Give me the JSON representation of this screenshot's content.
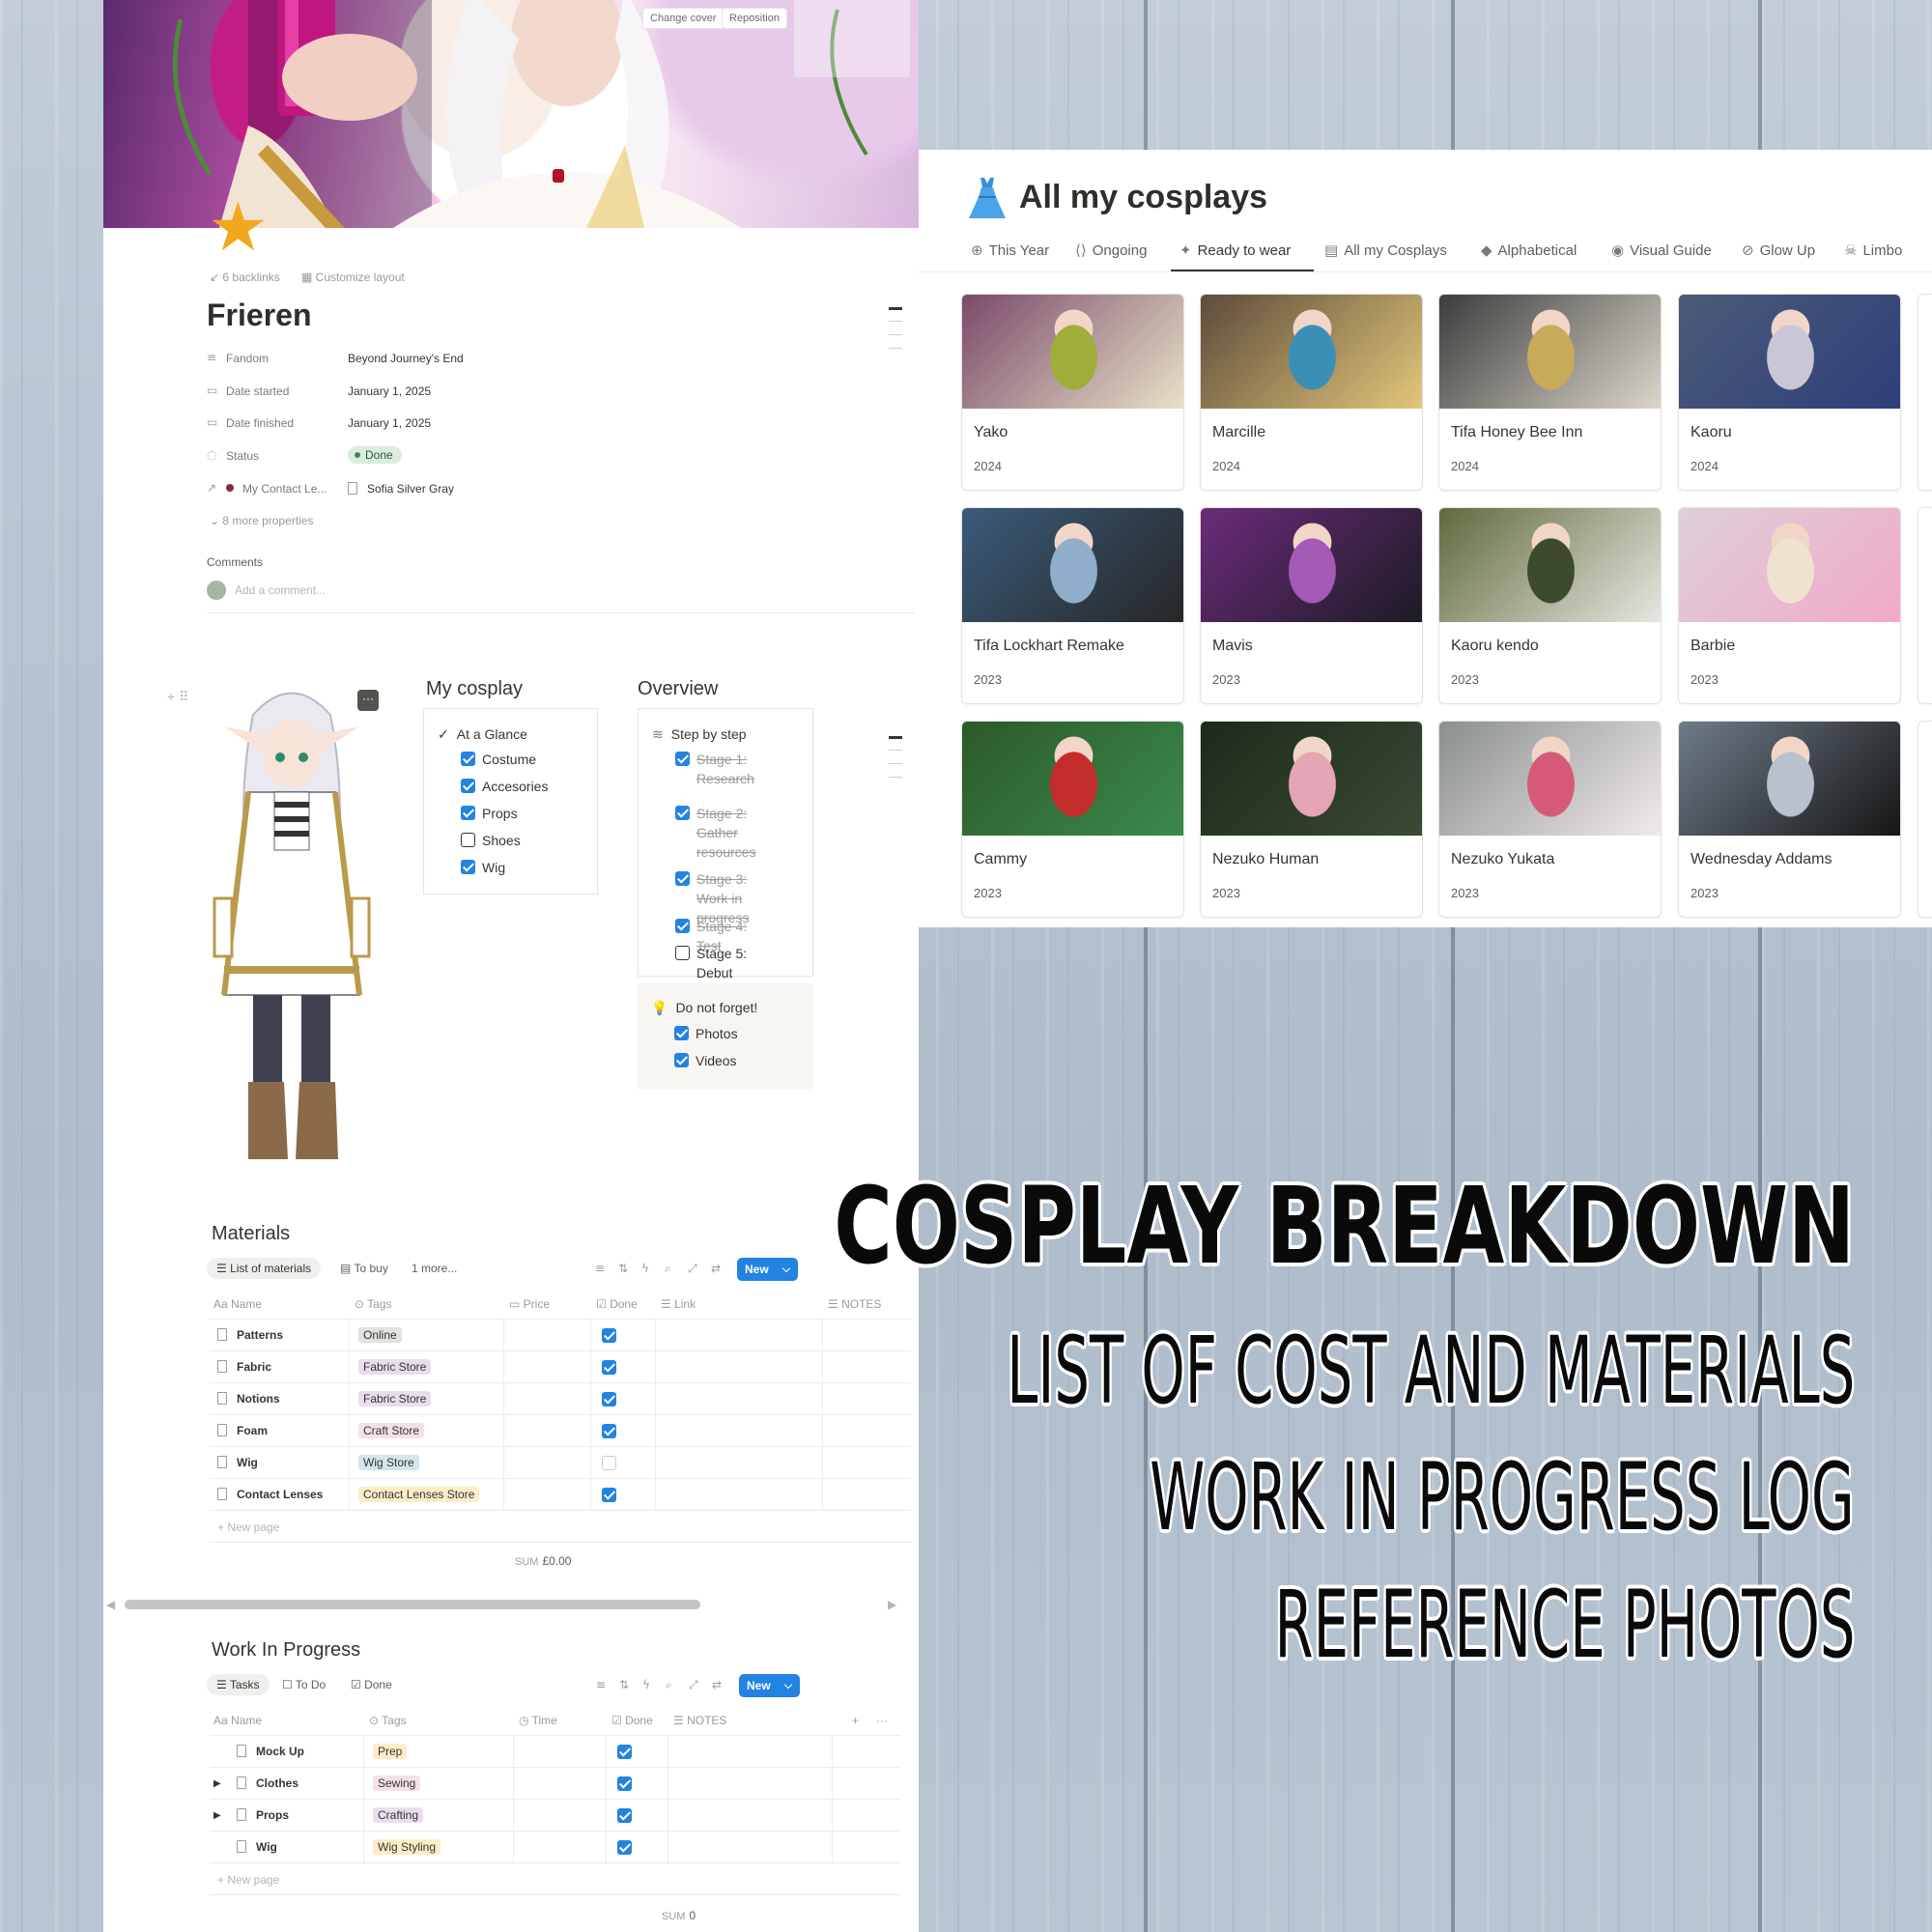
{
  "cover": {
    "change_cover": "Change cover",
    "reposition": "Reposition"
  },
  "page": {
    "backlinks": "6 backlinks",
    "customize": "Customize layout",
    "title": "Frieren",
    "properties": [
      {
        "icon": "text-lines-icon",
        "label": "Fandom",
        "value": "Beyond Journey's End"
      },
      {
        "icon": "calendar-icon",
        "label": "Date started",
        "value": "January 1, 2025"
      },
      {
        "icon": "calendar-icon",
        "label": "Date finished",
        "value": "January 1, 2025"
      },
      {
        "icon": "status-icon",
        "label": "Status",
        "value": "Done"
      },
      {
        "icon": "relation-arrow-icon",
        "label": "My Contact Le...",
        "value": "Sofia Silver Gray"
      }
    ],
    "more_properties": "8 more properties",
    "comments_label": "Comments",
    "comment_placeholder": "Add a comment..."
  },
  "my_cosplay": {
    "title": "My cosplay",
    "heading": "At a Glance",
    "items": [
      {
        "label": "Costume",
        "checked": true
      },
      {
        "label": "Accesories",
        "checked": true
      },
      {
        "label": "Props",
        "checked": true
      },
      {
        "label": "Shoes",
        "checked": false
      },
      {
        "label": "Wig",
        "checked": true
      }
    ]
  },
  "overview": {
    "title": "Overview",
    "heading": "Step by step",
    "items": [
      {
        "label": "Stage 1: Research",
        "checked": true
      },
      {
        "label": "Stage 2: Gather resources",
        "checked": true
      },
      {
        "label": "Stage 3: Work in progress",
        "checked": true
      },
      {
        "label": "Stage 4: Test",
        "checked": true
      },
      {
        "label": "Stage 5: Debut",
        "checked": false
      }
    ],
    "reminder_heading": "Do not forget!",
    "reminder_items": [
      {
        "label": "Photos",
        "checked": true
      },
      {
        "label": "Videos",
        "checked": true
      }
    ]
  },
  "materials": {
    "title": "Materials",
    "views": [
      "List of materials",
      "To buy",
      "1 more..."
    ],
    "new_label": "New",
    "columns": [
      "Name",
      "Tags",
      "Price",
      "Done",
      "Link",
      "NOTES"
    ],
    "rows": [
      {
        "name": "Patterns",
        "tag": "Online",
        "tag_color": "#e3e2e0",
        "done": true
      },
      {
        "name": "Fabric",
        "tag": "Fabric Store",
        "tag_color": "#e8deee",
        "done": true
      },
      {
        "name": "Notions",
        "tag": "Fabric Store",
        "tag_color": "#e8deee",
        "done": true
      },
      {
        "name": "Foam",
        "tag": "Craft Store",
        "tag_color": "#f5e0e9",
        "done": true
      },
      {
        "name": "Wig",
        "tag": "Wig Store",
        "tag_color": "#d3e5ef",
        "done": false
      },
      {
        "name": "Contact Lenses",
        "tag": "Contact Lenses Store",
        "tag_color": "#fdecc8",
        "done": true
      }
    ],
    "new_page": "New page",
    "sum_label": "SUM",
    "sum_value": "£0.00"
  },
  "wip": {
    "title": "Work In Progress",
    "views": [
      "Tasks",
      "To Do",
      "Done"
    ],
    "new_label": "New",
    "columns": [
      "Name",
      "Tags",
      "Time",
      "Done",
      "NOTES"
    ],
    "rows": [
      {
        "name": "Mock Up",
        "tag": "Prep",
        "tag_color": "#fdecc8",
        "expandable": false,
        "done": true
      },
      {
        "name": "Clothes",
        "tag": "Sewing",
        "tag_color": "#f5e0e9",
        "expandable": true,
        "done": true
      },
      {
        "name": "Props",
        "tag": "Crafting",
        "tag_color": "#e8deee",
        "expandable": true,
        "done": true
      },
      {
        "name": "Wig",
        "tag": "Wig Styling",
        "tag_color": "#fdecc8",
        "expandable": false,
        "done": true
      }
    ],
    "new_page": "New page",
    "sum_label": "SUM",
    "sum_value": "0"
  },
  "gallery": {
    "title": "All my cosplays",
    "tabs": [
      {
        "icon": "plus-circle-icon",
        "label": "This Year"
      },
      {
        "icon": "brackets-icon",
        "label": "Ongoing"
      },
      {
        "icon": "sparkle-icon",
        "label": "Ready to wear",
        "active": true
      },
      {
        "icon": "archive-icon",
        "label": "All my Cosplays"
      },
      {
        "icon": "tag-icon",
        "label": "Alphabetical"
      },
      {
        "icon": "eye-icon",
        "label": "Visual Guide"
      },
      {
        "icon": "no-image-icon",
        "label": "Glow Up"
      },
      {
        "icon": "skull-icon",
        "label": "Limbo"
      }
    ],
    "cards": [
      {
        "name": "Yako",
        "year": "2024",
        "c1": "#7a4a6a",
        "c2": "#e9e2c8",
        "c3": "#9fae3a"
      },
      {
        "name": "Marcille",
        "year": "2024",
        "c1": "#5d4a3a",
        "c2": "#e3c87a",
        "c3": "#3a8fb5"
      },
      {
        "name": "Tifa Honey Bee Inn",
        "year": "2024",
        "c1": "#3c3c3c",
        "c2": "#dcd7cc",
        "c3": "#c7ab5a"
      },
      {
        "name": "Kaoru",
        "year": "2024",
        "c1": "#4a5b77",
        "c2": "#2f3e7a",
        "c3": "#c9c6d6"
      },
      {
        "name": "Tifa Lockhart Remake",
        "year": "2023",
        "c1": "#3b5b7b",
        "c2": "#262626",
        "c3": "#8faec9"
      },
      {
        "name": "Mavis",
        "year": "2023",
        "c1": "#6b2b7a",
        "c2": "#1b1b24",
        "c3": "#a45bb8"
      },
      {
        "name": "Kaoru kendo",
        "year": "2023",
        "c1": "#5e6b3c",
        "c2": "#e9e7e2",
        "c3": "#3d4a2b"
      },
      {
        "name": "Barbie",
        "year": "2023",
        "c1": "#ddd0d8",
        "c2": "#f1a9c8",
        "c3": "#efe3d0"
      },
      {
        "name": "Cammy",
        "year": "2023",
        "c1": "#2c5a2a",
        "c2": "#3b8a4a",
        "c3": "#c42c2c"
      },
      {
        "name": "Nezuko Human",
        "year": "2023",
        "c1": "#1d2a1a",
        "c2": "#3a4a35",
        "c3": "#e6a5b5"
      },
      {
        "name": "Nezuko Yukata",
        "year": "2023",
        "c1": "#8a8f8f",
        "c2": "#f1eaea",
        "c3": "#d55a7a"
      },
      {
        "name": "Wednesday Addams",
        "year": "2023",
        "c1": "#6f7c8a",
        "c2": "#151515",
        "c3": "#b9c2cc"
      }
    ]
  },
  "overlay": {
    "headline": "COSPLAY BREAKDOWN",
    "lines": [
      "LIST OF COST AND MATERIALS",
      "WORK IN PROGRESS LOG",
      "REFERENCE PHOTOS"
    ]
  }
}
